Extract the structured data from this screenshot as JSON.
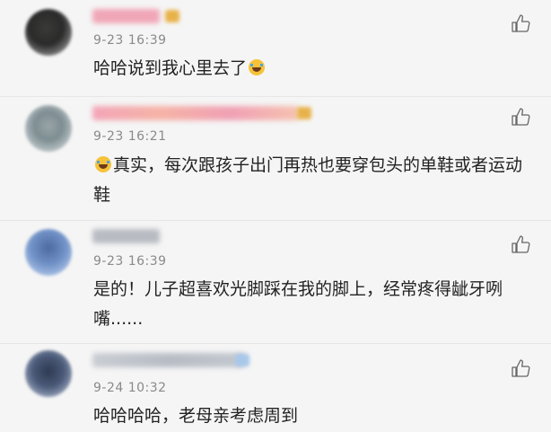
{
  "comments": [
    {
      "time": "9-23 16:39",
      "text_before": "哈哈说到我心里去了",
      "emoji": "laugh-cry-emoji",
      "text_after": ""
    },
    {
      "time": "9-23 16:21",
      "text_before": "",
      "emoji": "laugh-cry-emoji",
      "text_after": "真实，每次跟孩子出门再热也要穿包头的单鞋或者运动鞋"
    },
    {
      "time": "9-23 16:39",
      "text_before": "是的！儿子超喜欢光脚踩在我的脚上，经常疼得龇牙咧嘴......",
      "emoji": "",
      "text_after": ""
    },
    {
      "time": "9-24 10:32",
      "text_before": "哈哈哈哈，老母亲考虑周到",
      "emoji": "",
      "text_after": ""
    }
  ],
  "icons": {
    "like": "thumbs-up-icon"
  },
  "colors": {
    "background": "#f5f5f5",
    "timestamp": "#8a8a8a",
    "text": "#222222"
  }
}
